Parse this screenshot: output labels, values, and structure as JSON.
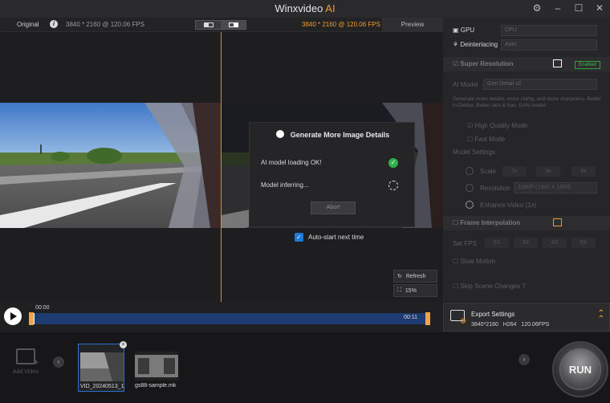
{
  "app": {
    "title_main": "Winxvideo",
    "title_ai": "AI"
  },
  "video_header": {
    "original_label": "Original",
    "original_info": "3840 * 2160 @ 120.06 FPS",
    "preview_info": "3840 * 2160 @ 120.06 FPS",
    "preview_tab": "Preview"
  },
  "dialog": {
    "title": "Generate More Image Details",
    "row1": "AI model loading OK!",
    "row2": "Model inferring...",
    "abort": "Abort"
  },
  "autostart": {
    "label": "Auto-start next time",
    "checked": true
  },
  "side_buttons": {
    "refresh": "Refresh",
    "zoom": "15%"
  },
  "timeline": {
    "start": "00:00",
    "end": "00:11"
  },
  "panel": {
    "gpu_label": "GPU",
    "gpu_value": "CPU",
    "deinterlacing_label": "Deinterlacing",
    "deinterlacing_value": "Auto",
    "super_resolution": "Super Resolution",
    "enabled": "Enabled",
    "ai_model_label": "AI Model",
    "ai_model_value": "Gen Detail v2",
    "ai_model_desc": "Generate more details, more clarity, and more sharpness. Better in Deblur, Better skin & hair, GAN model.",
    "high_quality": "High Quality Mode",
    "fast_mode": "Fast Mode",
    "model_settings": "Model Settings",
    "scale": "Scale",
    "scale_opts": [
      "2x",
      "3x",
      "4x"
    ],
    "resolution": "Resolution",
    "resolution_value": "1080P (1920 X 1080)",
    "enhance": "Enhance Video (1x)",
    "frame_interpolation": "Frame Interpolation",
    "set_fps": "Set FPS",
    "fps_opts": [
      "2X",
      "3X",
      "4X",
      "5X"
    ],
    "slow_motion": "Slow Motion",
    "skip_scene": "Skip Scene Changes"
  },
  "export": {
    "title": "Export Settings",
    "resolution": "3840*2160",
    "codec": "H264",
    "fps": "120.06FPS"
  },
  "bottom": {
    "add_video": "Add Video",
    "files": [
      "VID_20240513_1",
      "gs88-sample.mk"
    ],
    "run": "RUN"
  }
}
